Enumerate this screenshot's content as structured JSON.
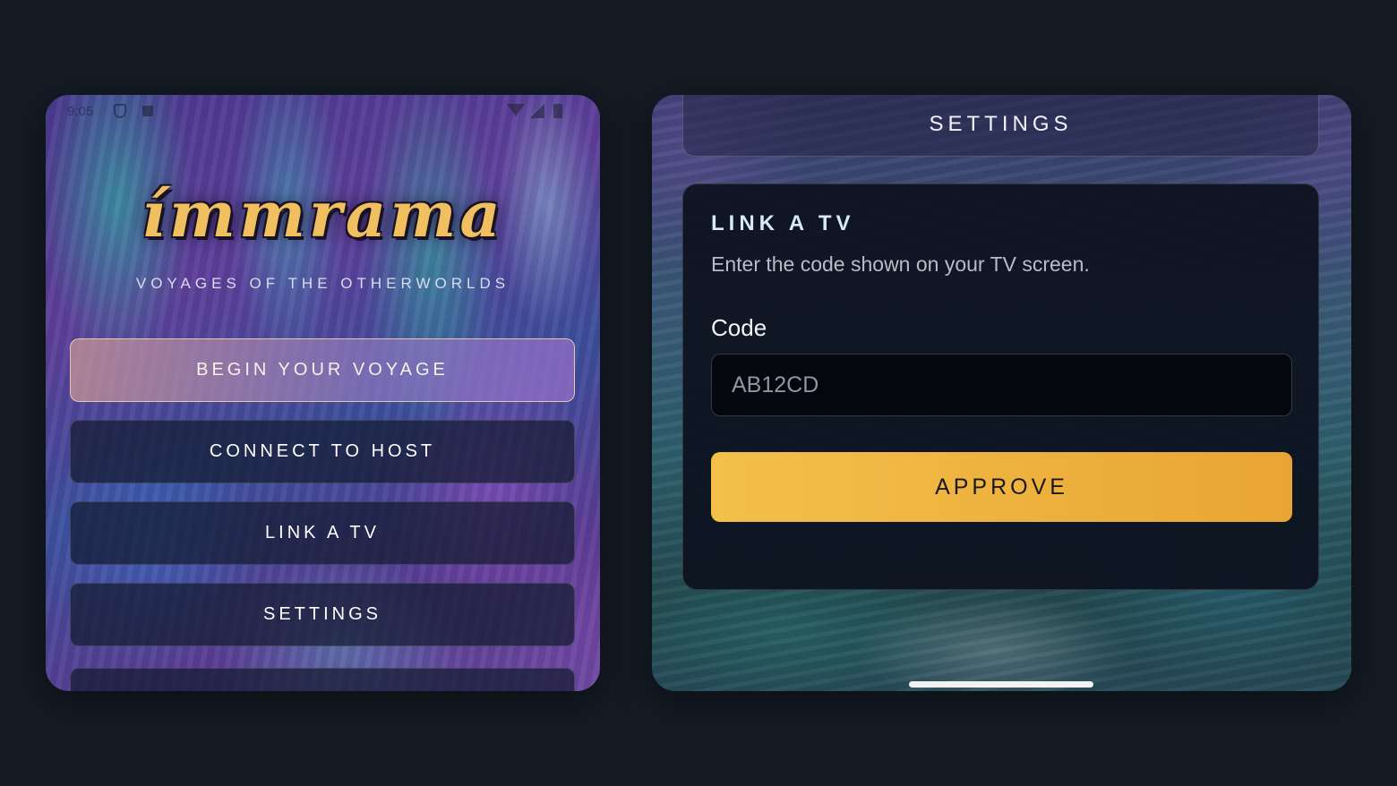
{
  "left_screen": {
    "status_bar": {
      "time": "9:05"
    },
    "logo": "ímmrama",
    "tagline": "VOYAGES OF THE OTHERWORLDS",
    "menu": [
      {
        "label": "BEGIN YOUR VOYAGE"
      },
      {
        "label": "CONNECT TO HOST"
      },
      {
        "label": "LINK A TV"
      },
      {
        "label": "SETTINGS"
      }
    ]
  },
  "right_screen": {
    "header": "SETTINGS",
    "card": {
      "title": "LINK A TV",
      "description": "Enter the code shown on your TV screen.",
      "code_label": "Code",
      "code_placeholder": "AB12CD",
      "code_value": "",
      "approve_label": "APPROVE"
    }
  },
  "colors": {
    "page_background": "#141b24",
    "accent_gold": "#f3c04a",
    "card_background": "#0d111e"
  },
  "icons": [
    "shield-icon",
    "notification-badge-icon",
    "wifi-icon",
    "signal-icon",
    "battery-icon"
  ]
}
